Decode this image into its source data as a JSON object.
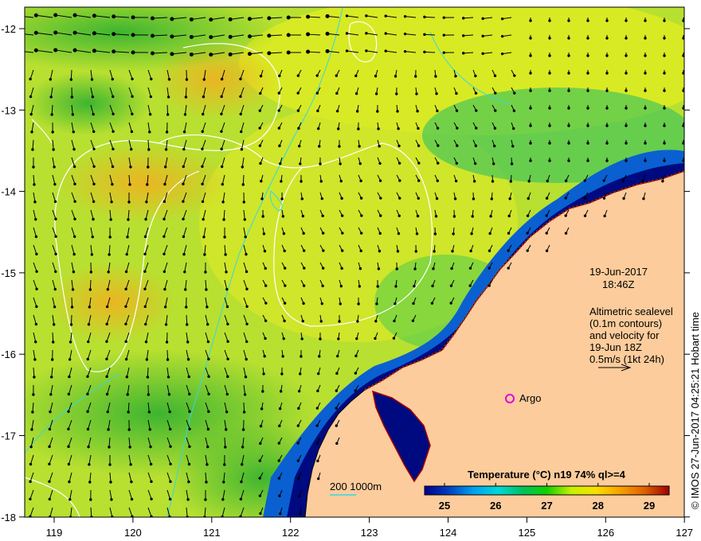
{
  "map": {
    "lon_ticks": [
      "119",
      "120",
      "121",
      "122",
      "123",
      "124",
      "125",
      "126",
      "127"
    ],
    "lat_ticks": [
      "-12",
      "-13",
      "-14",
      "-15",
      "-16",
      "-17",
      "-18"
    ],
    "lon_range": [
      118.62,
      127
    ],
    "lat_range": [
      -11.73,
      -18
    ]
  },
  "annotation": {
    "date": "19-Jun-2017",
    "time": "18:46Z",
    "altimetry_lines": [
      "Altimetric sealevel",
      "(0.1m contours)",
      "and velocity for",
      "19-Jun 18Z",
      "0.5m/s (1kt 24h)"
    ]
  },
  "argo_label": "Argo",
  "depth_legend": "200  1000m",
  "colorbar": {
    "title": "Temperature (°C) n19 74% ql>=4",
    "ticks": [
      "25",
      "26",
      "27",
      "28",
      "29"
    ],
    "range": [
      24.6,
      29.4
    ],
    "colors": [
      "#00008b",
      "#0040c0",
      "#00a0f0",
      "#00d8d8",
      "#00c060",
      "#10d000",
      "#c8f000",
      "#f8e000",
      "#f8a000",
      "#e06000",
      "#a00000"
    ]
  },
  "credit": "© IMOS 27-Jun-2017 04:25:21 Hobart time"
}
